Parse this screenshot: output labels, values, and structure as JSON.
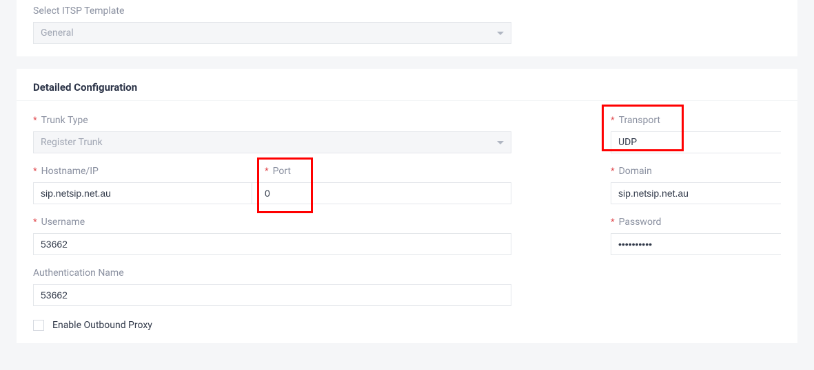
{
  "top": {
    "itsp_label": "Select ITSP Template",
    "itsp_value": "General"
  },
  "section_title": "Detailed Configuration",
  "left": {
    "trunk_type_label": "Trunk Type",
    "trunk_type_value": "Register Trunk",
    "hostname_label": "Hostname/IP",
    "hostname_value": "sip.netsip.net.au",
    "port_label": "Port",
    "port_value": "0",
    "username_label": "Username",
    "username_value": "53662",
    "authname_label": "Authentication Name",
    "authname_value": "53662",
    "enable_proxy_label": "Enable Outbound Proxy"
  },
  "right": {
    "transport_label": "Transport",
    "transport_value": "UDP",
    "domain_label": "Domain",
    "domain_value": "sip.netsip.net.au",
    "password_label": "Password",
    "password_value": "••••••••••"
  }
}
